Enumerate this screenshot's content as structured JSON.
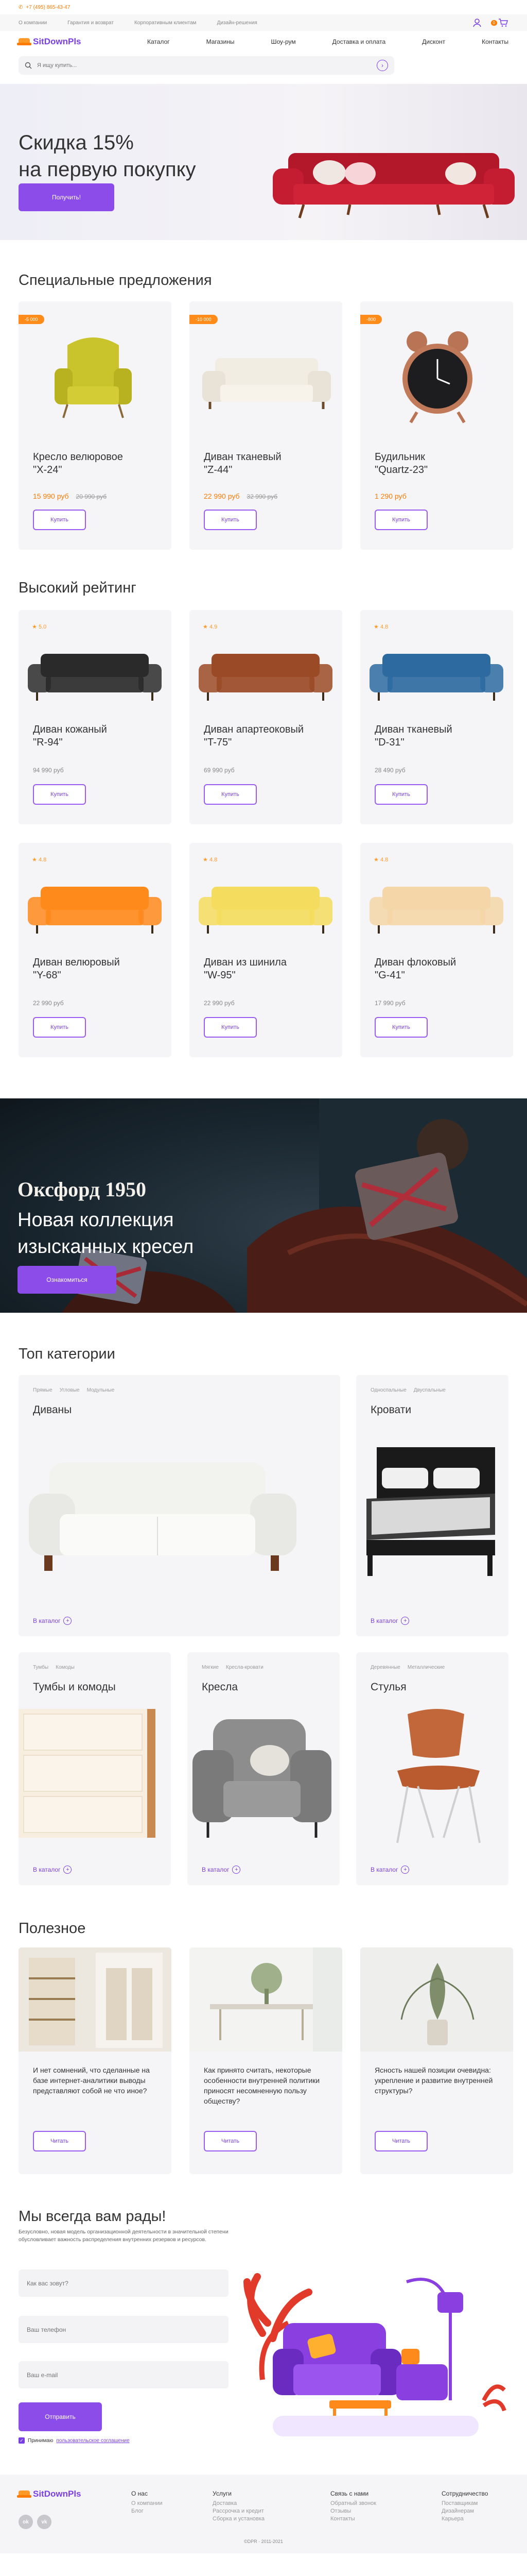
{
  "topbar": {
    "phone": "+7 (495) 865-43-47"
  },
  "subnav": {
    "links": [
      "О компании",
      "Гарантия и возврат",
      "Корпоративным клиентам",
      "Дизайн-решения"
    ],
    "cart_count": "0"
  },
  "header": {
    "logo": "SitDownPls",
    "nav": [
      "Каталог",
      "Магазины",
      "Шоу-рум",
      "Доставка и оплата",
      "Дисконт",
      "Контакты"
    ]
  },
  "search": {
    "placeholder": "Я ищу купить..."
  },
  "hero": {
    "title_line1": "Скидка 15%",
    "title_line2": "на первую покупку",
    "button": "Получить!"
  },
  "specials": {
    "title": "Специальные предложения",
    "items": [
      {
        "tag": "-5 000",
        "name_line1": "Кресло велюровое",
        "name_line2": "\"Х-24\"",
        "price": "15 990 руб",
        "old_price": "20 990 руб",
        "button": "Купить"
      },
      {
        "tag": "-10 000",
        "name_line1": "Диван тканевый",
        "name_line2": "\"Z-44\"",
        "price": "22 990 руб",
        "old_price": "32 990 руб",
        "button": "Купить"
      },
      {
        "tag": "-800",
        "name_line1": "Будильник",
        "name_line2": "\"Quartz-23\"",
        "price": "1 290 руб",
        "old_price": "",
        "button": "Купить"
      }
    ]
  },
  "rating": {
    "title": "Высокий рейтинг",
    "items": [
      {
        "rating": "5.0",
        "name_line1": "Диван кожаный",
        "name_line2": "\"R-94\"",
        "price": "94 990 руб",
        "button": "Купить",
        "color": "#2a2a2a"
      },
      {
        "rating": "4.9",
        "name_line1": "Диван апартеоковый",
        "name_line2": "\"T-75\"",
        "price": "69 990 руб",
        "button": "Купить",
        "color": "#9a4a26"
      },
      {
        "rating": "4.8",
        "name_line1": "Диван тканевый",
        "name_line2": "\"D-31\"",
        "price": "28 490 руб",
        "button": "Купить",
        "color": "#2d6aa0"
      },
      {
        "rating": "4.8",
        "name_line1": "Диван велюровый",
        "name_line2": "\"Y-68\"",
        "price": "22 990 руб",
        "button": "Купить",
        "color": "#ff8a1c"
      },
      {
        "rating": "4.8",
        "name_line1": "Диван из шинила",
        "name_line2": "\"W-95\"",
        "price": "22 990 руб",
        "button": "Купить",
        "color": "#f4dc5e"
      },
      {
        "rating": "4.8",
        "name_line1": "Диван флоковый",
        "name_line2": "\"G-41\"",
        "price": "17 990 руб",
        "button": "Купить",
        "color": "#f4d6a8"
      }
    ]
  },
  "banner": {
    "title": "Оксфорд 1950",
    "subtitle": "Новая коллекция изысканных кресел",
    "button": "Ознакомиться"
  },
  "categories": {
    "title": "Топ категории",
    "items": [
      {
        "subs": [
          "Прямые",
          "Угловые",
          "Модульные"
        ],
        "name": "Диваны",
        "more": "В каталог"
      },
      {
        "subs": [
          "Односпальные",
          "Двуспальные"
        ],
        "name": "Кровати",
        "more": "В каталог"
      },
      {
        "subs": [
          "Тумбы",
          "Комоды"
        ],
        "name": "Тумбы и комоды",
        "more": "В каталог"
      },
      {
        "subs": [
          "Мягкие",
          "Кресла-кровати"
        ],
        "name": "Кресла",
        "more": "В каталог"
      },
      {
        "subs": [
          "Деревянные",
          "Металлические"
        ],
        "name": "Стулья",
        "more": "В каталог"
      }
    ]
  },
  "articles": {
    "title": "Полезное",
    "items": [
      {
        "text": "И нет сомнений, что сделанные на базе интернет-аналитики выводы представляют собой не что иное?",
        "button": "Читать"
      },
      {
        "text": "Как принято считать, некоторые особенности внутренней политики приносят несомненную пользу обществу?",
        "button": "Читать"
      },
      {
        "text": "Ясность нашей позиции очевидна: укрепление и развитие внутренней структуры?",
        "button": "Читать"
      }
    ]
  },
  "contact": {
    "title": "Мы всегда вам рады!",
    "lead": "Безусловно, новая модель организационной деятельности в значительной степени обусловливает важность распределения внутренних резервов и ресурсов.",
    "name_placeholder": "Как вас зовут?",
    "phone_placeholder": "Ваш телефон",
    "email_placeholder": "Ваш e-mail",
    "button": "Отправить",
    "agree_text": "Принимаю",
    "agree_link": "пользовательское соглашение"
  },
  "footer": {
    "logo": "SitDownPls",
    "social": [
      "ok",
      "vk"
    ],
    "cols": [
      {
        "title": "О нас",
        "links": [
          "О компании",
          "Блог"
        ]
      },
      {
        "title": "Услуги",
        "links": [
          "Доставка",
          "Рассрочка и кредит",
          "Сборка и установка"
        ]
      },
      {
        "title": "Связь с нами",
        "links": [
          "Обратный звонок",
          "Отзывы",
          "Контакты"
        ]
      },
      {
        "title": "Сотрудничество",
        "links": [
          "Поставщикам",
          "Дизайнерам",
          "Карьера"
        ]
      }
    ],
    "copyright": "©DPR · 2011-2021"
  },
  "colors": {
    "accent": "#8c4cea",
    "orange": "#ff7a00",
    "card": "#f5f5f7"
  }
}
